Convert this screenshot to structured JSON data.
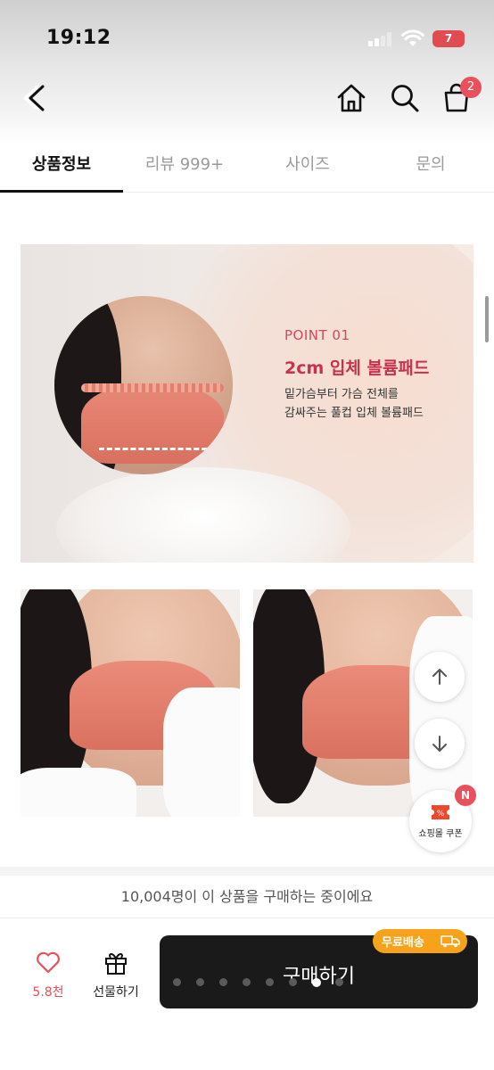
{
  "status_bar": {
    "time": "19:12",
    "battery": "7"
  },
  "nav": {
    "back_icon": "chevron-left-icon",
    "home_icon": "home-icon",
    "search_icon": "search-icon",
    "cart_icon": "shopping-bag-icon",
    "cart_badge": "2"
  },
  "tabs": [
    {
      "label": "상품정보",
      "active": true
    },
    {
      "label": "리뷰 999+",
      "active": false
    },
    {
      "label": "사이즈",
      "active": false
    },
    {
      "label": "문의",
      "active": false
    }
  ],
  "hero": {
    "point_label": "POINT 01",
    "title": "2cm 입체 볼륨패드",
    "desc_line1": "밑가슴부터 가슴 전체를",
    "desc_line2": "감싸주는 풀컵 입체 볼륨패드"
  },
  "floating": {
    "scroll_up_icon": "arrow-up-icon",
    "scroll_down_icon": "arrow-down-icon",
    "coupon_label": "쇼핑몰 쿠폰",
    "coupon_badge": "N"
  },
  "buyers_text": "10,004명이 이 상품을 구매하는 중이에요",
  "bottom": {
    "like_count": "5.8천",
    "gift_label": "선물하기",
    "buy_label": "구매하기",
    "free_shipping": "무료배송"
  },
  "colors": {
    "accent": "#e8505b",
    "buy_button": "#1a1a1a",
    "free_shipping": "#f7a21b",
    "point_text": "#c8324e"
  }
}
